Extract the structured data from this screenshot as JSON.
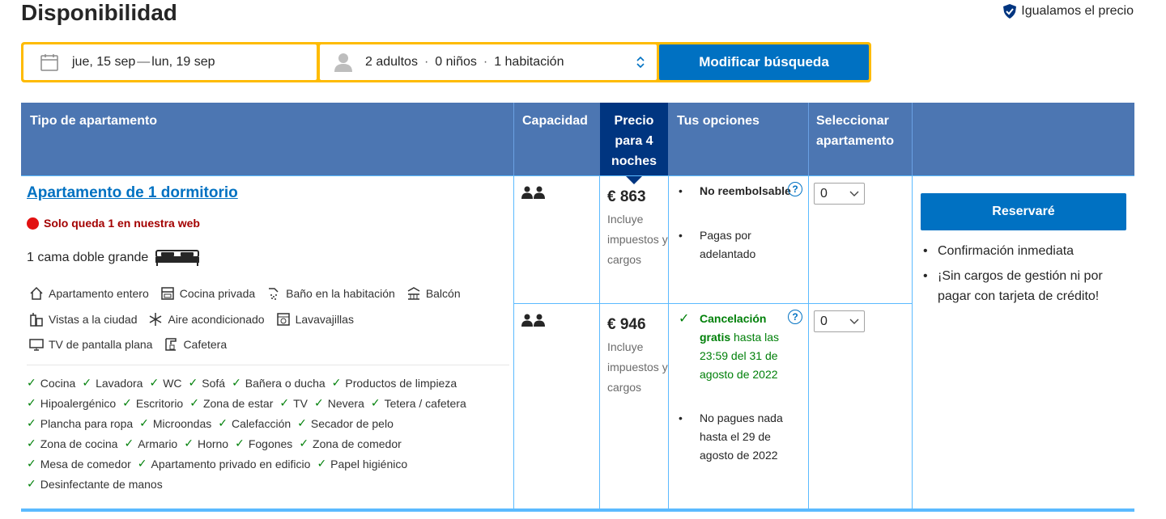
{
  "page": {
    "title": "Disponibilidad",
    "price_match": "Igualamos el precio"
  },
  "search": {
    "dates_start": "jue, 15 sep",
    "dates_sep": "—",
    "dates_end": "lun, 19 sep",
    "adults": "2 adultos",
    "children": "0 niños",
    "rooms": "1 habitación",
    "dot": "·",
    "modify_label": "Modificar búsqueda"
  },
  "table": {
    "headers": {
      "type": "Tipo de apartamento",
      "capacity": "Capacidad",
      "price": "Precio para 4 noches",
      "options": "Tus opciones",
      "select": "Seleccionar apartamento"
    }
  },
  "room": {
    "name": "Apartamento de 1 dormitorio",
    "scarcity": "Solo queda 1 en nuestra web",
    "bed": "1 cama doble grande",
    "facilities": [
      {
        "label": "Apartamento entero",
        "icon": "house-icon"
      },
      {
        "label": "Cocina privada",
        "icon": "kitchen-icon"
      },
      {
        "label": "Baño en la habitación",
        "icon": "shower-icon"
      },
      {
        "label": "Balcón",
        "icon": "balcony-icon"
      },
      {
        "label": "Vistas a la ciudad",
        "icon": "city-icon"
      },
      {
        "label": "Aire acondicionado",
        "icon": "snowflake-icon"
      },
      {
        "label": "Lavavajillas",
        "icon": "dishwasher-icon"
      },
      {
        "label": "TV de pantalla plana",
        "icon": "tv-icon"
      },
      {
        "label": "Cafetera",
        "icon": "coffee-machine-icon"
      }
    ],
    "amenities": [
      [
        "Cocina",
        "Lavadora",
        "WC",
        "Sofá",
        "Bañera o ducha",
        "Productos de limpieza"
      ],
      [
        "Hipoalergénico",
        "Escritorio",
        "Zona de estar",
        "TV",
        "Nevera",
        "Tetera / cafetera"
      ],
      [
        "Plancha para ropa",
        "Microondas",
        "Calefacción",
        "Secador de pelo"
      ],
      [
        "Zona de cocina",
        "Armario",
        "Horno",
        "Fogones",
        "Zona de comedor"
      ],
      [
        "Mesa de comedor",
        "Apartamento privado en edificio",
        "Papel higiénico"
      ],
      [
        "Desinfectante de manos"
      ]
    ]
  },
  "offers": [
    {
      "price": "€ 863",
      "note": "Incluye impuestos y cargos",
      "opt1_bold": "No reembolsable",
      "opt2": "Pagas por adelantado",
      "selected": "0"
    },
    {
      "price": "€ 946",
      "note": "Incluye impuestos y cargos",
      "opt1_bold": "Cancelación gratis",
      "opt1_rest": "hasta las 23:59 del 31 de agosto de 2022",
      "opt2": "No pagues nada hasta el 29 de agosto de 2022",
      "selected": "0"
    }
  ],
  "reserve": {
    "label": "Reservaré",
    "benefits": [
      "Confirmación inmediata",
      "¡Sin cargos de gestión ni por pagar con tarjeta de crédito!"
    ]
  },
  "colors": {
    "brand_blue": "#0071c2",
    "header_blue": "#4c76b2",
    "dark_blue": "#003580",
    "search_yellow": "#febb02",
    "green": "#008009",
    "scarcity_red": "#a30000"
  }
}
